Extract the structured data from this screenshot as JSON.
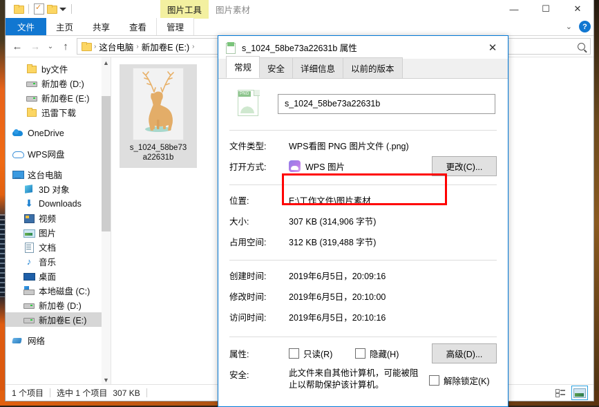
{
  "desktop": {
    "bg_top": "#4a3a20",
    "bg_orange": "#e8631a",
    "bg_blue": "#1c2a3a"
  },
  "explorer": {
    "quick_access": [
      {
        "name": "folder-icon",
        "label": ""
      },
      {
        "name": "properties-icon",
        "label": ""
      },
      {
        "name": "new-folder-icon",
        "label": ""
      },
      {
        "name": "customize-caret-icon",
        "label": ""
      }
    ],
    "context_tabs": [
      {
        "label": "图片工具",
        "active": true
      },
      {
        "label": "图片素材",
        "active": false
      }
    ],
    "window_controls": {
      "minimize": "—",
      "maximize": "☐",
      "close": "✕"
    },
    "ribbon_tabs": [
      {
        "label": "文件",
        "active": true
      },
      {
        "label": "主页",
        "active": false
      },
      {
        "label": "共享",
        "active": false
      },
      {
        "label": "查看",
        "active": false
      },
      {
        "label": "管理",
        "active": false
      }
    ],
    "ribbon_right": {
      "collapse": "⌄",
      "help": "?"
    },
    "address": {
      "back": "←",
      "forward": "→",
      "recent": "⌄",
      "up": "↑",
      "crumbs": [
        "这台电脑",
        "新加卷E (E:)"
      ],
      "separator": "›",
      "search_placeholder": ""
    },
    "nav_pane": [
      {
        "label": "by文件",
        "icon": "folder-icon",
        "indent": 1,
        "selected": false
      },
      {
        "label": "新加卷 (D:)",
        "icon": "drive-icon",
        "indent": 1,
        "selected": false
      },
      {
        "label": "新加卷E (E:)",
        "icon": "drive-icon",
        "indent": 1,
        "selected": false
      },
      {
        "label": "迅雷下载",
        "icon": "folder-icon",
        "indent": 1,
        "selected": false
      },
      {
        "label": "OneDrive",
        "icon": "onedrive-icon",
        "indent": 0,
        "selected": false
      },
      {
        "label": "WPS网盘",
        "icon": "wps-cloud-icon",
        "indent": 0,
        "selected": false
      },
      {
        "label": "这台电脑",
        "icon": "this-pc-icon",
        "indent": 0,
        "selected": false
      },
      {
        "label": "3D 对象",
        "icon": "cube-icon",
        "indent": 1,
        "selected": false
      },
      {
        "label": "Downloads",
        "icon": "download-icon",
        "indent": 1,
        "selected": false
      },
      {
        "label": "视频",
        "icon": "video-icon",
        "indent": 1,
        "selected": false
      },
      {
        "label": "图片",
        "icon": "pictures-icon",
        "indent": 1,
        "selected": false
      },
      {
        "label": "文档",
        "icon": "documents-icon",
        "indent": 1,
        "selected": false
      },
      {
        "label": "音乐",
        "icon": "music-icon",
        "indent": 1,
        "selected": false
      },
      {
        "label": "桌面",
        "icon": "desktop-icon",
        "indent": 1,
        "selected": false
      },
      {
        "label": "本地磁盘 (C:)",
        "icon": "system-drive-icon",
        "indent": 1,
        "selected": false
      },
      {
        "label": "新加卷 (D:)",
        "icon": "drive-icon",
        "indent": 1,
        "selected": false
      },
      {
        "label": "新加卷E (E:)",
        "icon": "drive-icon",
        "indent": 1,
        "selected": true
      },
      {
        "label": "网络",
        "icon": "network-icon",
        "indent": 0,
        "selected": false
      }
    ],
    "file_tile": {
      "label_line1": "s_1024_58be73",
      "label_line2": "a22631b",
      "thumbnail": "deer-illustration"
    },
    "status_bar": {
      "item_count": "1 个项目",
      "selection": "选中 1 个项目",
      "size": "307 KB"
    },
    "view_buttons": [
      {
        "name": "details-view-button",
        "selected": false
      },
      {
        "name": "large-icons-view-button",
        "selected": true
      }
    ]
  },
  "dialog": {
    "title": "s_1024_58be73a22631b 属性",
    "close_label": "✕",
    "tabs": [
      {
        "label": "常规",
        "active": true
      },
      {
        "label": "安全",
        "active": false
      },
      {
        "label": "详细信息",
        "active": false
      },
      {
        "label": "以前的版本",
        "active": false
      }
    ],
    "file_name": "s_1024_58be73a22631b",
    "rows": {
      "file_type_label": "文件类型:",
      "file_type_value": "WPS看图 PNG 图片文件 (.png)",
      "open_with_label": "打开方式:",
      "open_with_value": "WPS 图片",
      "change_button": "更改(C)...",
      "location_label": "位置:",
      "location_value": "E:\\工作文件\\图片素材",
      "size_label": "大小:",
      "size_value": "307 KB (314,906 字节)",
      "disk_size_label": "占用空间:",
      "disk_size_value": "312 KB (319,488 字节)",
      "created_label": "创建时间:",
      "created_value": "2019年6月5日，20:09:16",
      "modified_label": "修改时间:",
      "modified_value": "2019年6月5日，20:10:00",
      "accessed_label": "访问时间:",
      "accessed_value": "2019年6月5日，20:10:16",
      "attributes_label": "属性:",
      "readonly_label": "只读(R)",
      "hidden_label": "隐藏(H)",
      "advanced_button": "高级(D)...",
      "security_label": "安全:",
      "security_text": "此文件来自其他计算机，可能被阻止以帮助保护该计算机。",
      "unblock_label": "解除锁定(K)"
    },
    "annotation": {
      "type": "red-rectangle",
      "color": "#ff0000",
      "targets": "file_type_value"
    }
  }
}
